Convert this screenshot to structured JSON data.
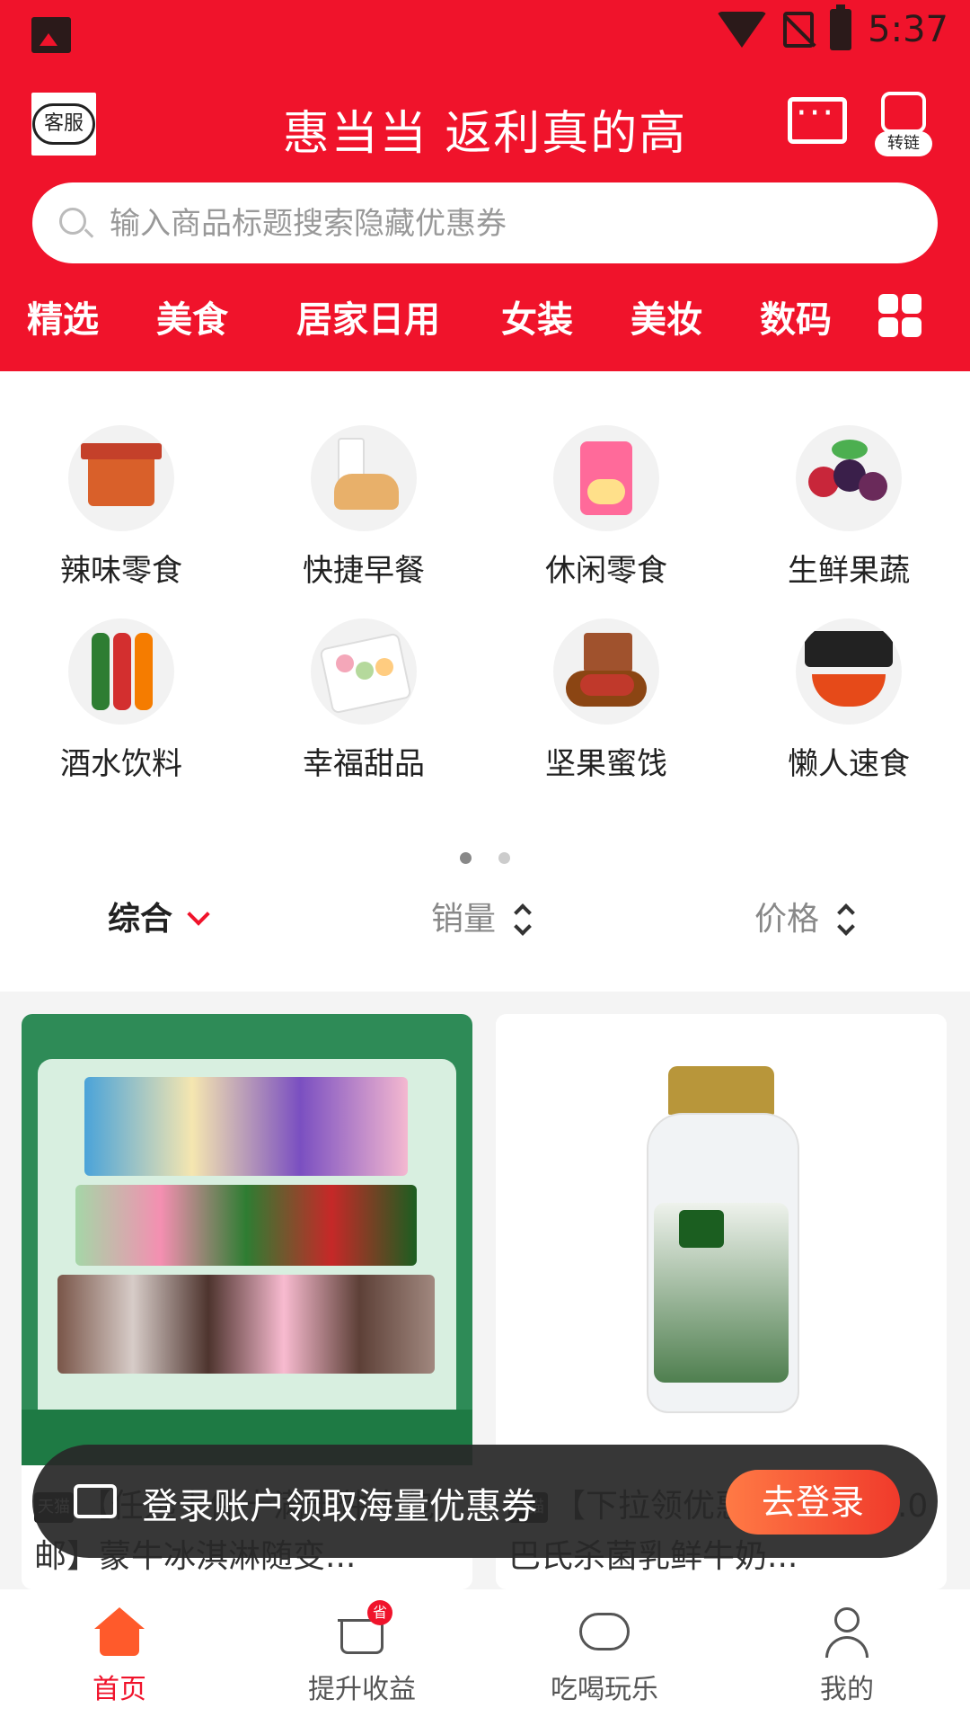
{
  "status_bar": {
    "time": "5:37"
  },
  "header": {
    "customer_service_label": "客服",
    "title": "惠当当 返利真的高",
    "convert_link_label": "转链"
  },
  "search": {
    "placeholder": "输入商品标题搜索隐藏优惠券"
  },
  "categories": [
    "精选",
    "美食",
    "居家日用",
    "女装",
    "美妆",
    "数码"
  ],
  "quick_entries": [
    {
      "label": "辣味零食",
      "icon": "spicy-snack-icon"
    },
    {
      "label": "快捷早餐",
      "icon": "breakfast-icon"
    },
    {
      "label": "休闲零食",
      "icon": "snack-icon"
    },
    {
      "label": "生鲜果蔬",
      "icon": "fresh-fruit-icon"
    },
    {
      "label": "酒水饮料",
      "icon": "drinks-icon"
    },
    {
      "label": "幸福甜品",
      "icon": "dessert-icon"
    },
    {
      "label": "坚果蜜饯",
      "icon": "nuts-icon"
    },
    {
      "label": "懒人速食",
      "icon": "instant-food-icon"
    }
  ],
  "sort": {
    "comprehensive": "综合",
    "sales": "销量",
    "price": "价格"
  },
  "products": [
    {
      "store_badge": "天猫",
      "title": "【任选十件十满十件十包邮】蒙牛冰淇淋随变...",
      "image": "ice-cream-product-image"
    },
    {
      "store_badge": "天猫",
      "title": "【下拉领优惠券】金典4.0巴氏杀菌乳鲜牛奶...",
      "image": "milk-bottle-product-image"
    }
  ],
  "toast": {
    "text": "登录账户领取海量优惠券",
    "button": "去登录"
  },
  "tabbar": [
    {
      "label": "首页"
    },
    {
      "label": "提升收益",
      "badge": "省"
    },
    {
      "label": "吃喝玩乐"
    },
    {
      "label": "我的"
    }
  ],
  "colors": {
    "brand_red": "#f0132b",
    "login_orange": "#ff6a3d"
  }
}
